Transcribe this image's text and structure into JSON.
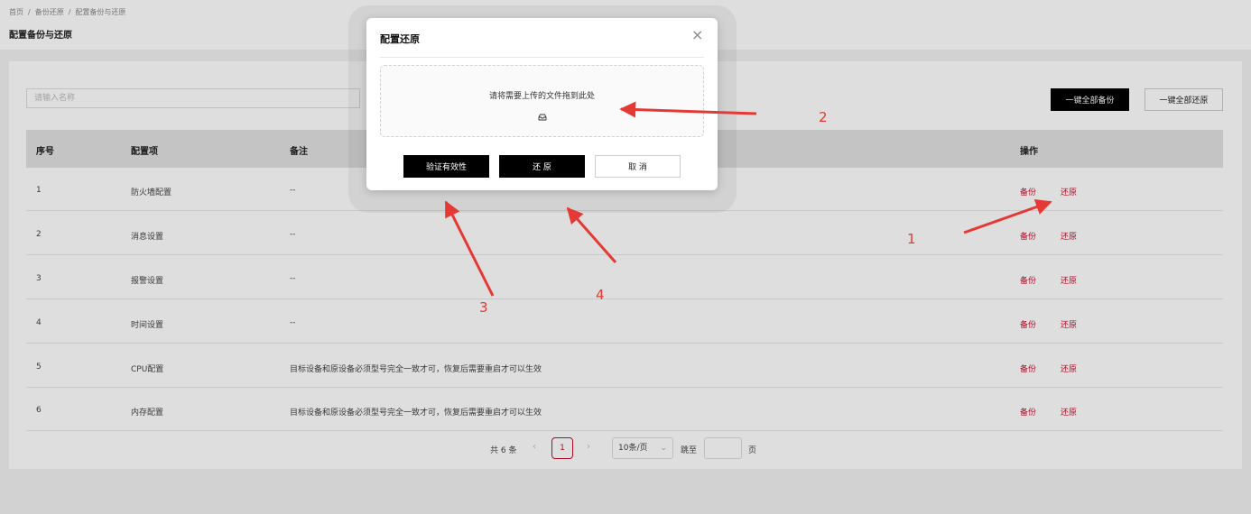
{
  "breadcrumb": {
    "items": [
      "首页",
      "备份还原",
      "配置备份与还原"
    ],
    "separator": "/"
  },
  "page": {
    "title": "配置备份与还原"
  },
  "search": {
    "placeholder": "请输入名称"
  },
  "toolbar": {
    "backup_all": "一键全部备份",
    "restore_all": "一键全部还原"
  },
  "table": {
    "headers": {
      "index": "序号",
      "item": "配置项",
      "remark": "备注",
      "actions": "操作"
    },
    "rows": [
      {
        "index": "1",
        "item": "防火墙配置",
        "remark": "--",
        "backup": "备份",
        "restore": "还原"
      },
      {
        "index": "2",
        "item": "消息设置",
        "remark": "--",
        "backup": "备份",
        "restore": "还原"
      },
      {
        "index": "3",
        "item": "报警设置",
        "remark": "--",
        "backup": "备份",
        "restore": "还原"
      },
      {
        "index": "4",
        "item": "时间设置",
        "remark": "--",
        "backup": "备份",
        "restore": "还原"
      },
      {
        "index": "5",
        "item": "CPU配置",
        "remark": "目标设备和原设备必须型号完全一致才可，恢复后需要重启才可以生效",
        "backup": "备份",
        "restore": "还原"
      },
      {
        "index": "6",
        "item": "内存配置",
        "remark": "目标设备和原设备必须型号完全一致才可，恢复后需要重启才可以生效",
        "backup": "备份",
        "restore": "还原"
      }
    ]
  },
  "pagination": {
    "total_text": "共 6 条",
    "current_page": "1",
    "page_size": "10条/页",
    "jump_label": "跳至",
    "page_suffix": "页",
    "prev_icon": "chevron-left-icon",
    "next_icon": "chevron-right-icon"
  },
  "modal": {
    "title": "配置还原",
    "close_icon": "close-icon",
    "dropzone_text": "请将需要上传的文件拖到此处",
    "upload_icon": "inbox-icon",
    "verify_label": "验证有效性",
    "restore_label": "还 原",
    "cancel_label": "取 消"
  },
  "annotations": [
    "1",
    "2",
    "3",
    "4"
  ],
  "colors": {
    "accent": "#c8102e",
    "annotation": "#e53935",
    "dark_button": "#000000"
  }
}
